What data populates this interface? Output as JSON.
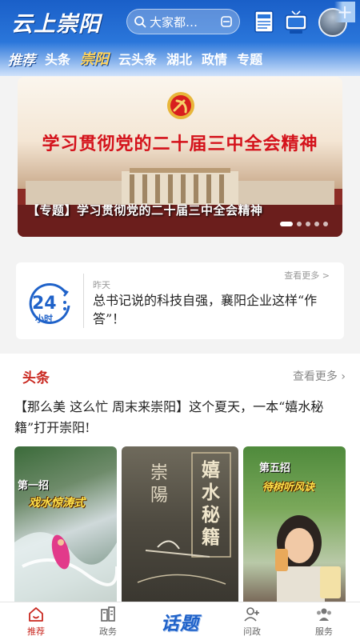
{
  "header": {
    "app_logo": "云上崇阳",
    "search_placeholder": "大家都…",
    "icons": [
      "search-icon",
      "scan-icon",
      "newspaper-icon",
      "tv-icon",
      "avatar"
    ]
  },
  "tabs": [
    {
      "label": "推荐",
      "style": "first"
    },
    {
      "label": "头条",
      "style": "normal"
    },
    {
      "label": "崇阳",
      "style": "special"
    },
    {
      "label": "云头条",
      "style": "normal"
    },
    {
      "label": "湖北",
      "style": "normal"
    },
    {
      "label": "政情",
      "style": "normal"
    },
    {
      "label": "专题",
      "style": "normal"
    }
  ],
  "tabs_plus": "+",
  "banner": {
    "headline": "学习贯彻党的二十届三中全会精神",
    "caption": "【专题】学习贯彻党的二十届三中全会精神",
    "slide_count": 5,
    "active_slide": 1
  },
  "news24": {
    "icon_number": "24",
    "icon_unit": "小时",
    "more": "查看更多 >",
    "time": "昨天",
    "text": "总书记说的科技自强，襄阳企业这样“作答”！"
  },
  "section": {
    "title": "头条",
    "more": "查看更多",
    "article_title": "【那么美 这么忙 周末来崇阳】这个夏天，一本“嬉水秘籍”打开崇阳!",
    "thumbs": [
      {
        "label": "第一招",
        "sub": "戏水惊涛式"
      },
      {
        "vert_left": "崇陽",
        "vert_right": "嬉水秘籍"
      },
      {
        "label": "第五招",
        "sub": "待树听风诀"
      }
    ]
  },
  "bottom_nav": [
    {
      "label": "推荐",
      "icon": "home-icon",
      "active": true
    },
    {
      "label": "政务",
      "icon": "building-icon",
      "active": false
    },
    {
      "label": "话题",
      "icon": "",
      "active": false,
      "center": true
    },
    {
      "label": "问政",
      "icon": "person-add-icon",
      "active": false
    },
    {
      "label": "服务",
      "icon": "group-icon",
      "active": false
    }
  ],
  "colors": {
    "header_blue": "#1a5fc8",
    "accent_red": "#c9271f",
    "topic_blue": "#1f62c9"
  }
}
